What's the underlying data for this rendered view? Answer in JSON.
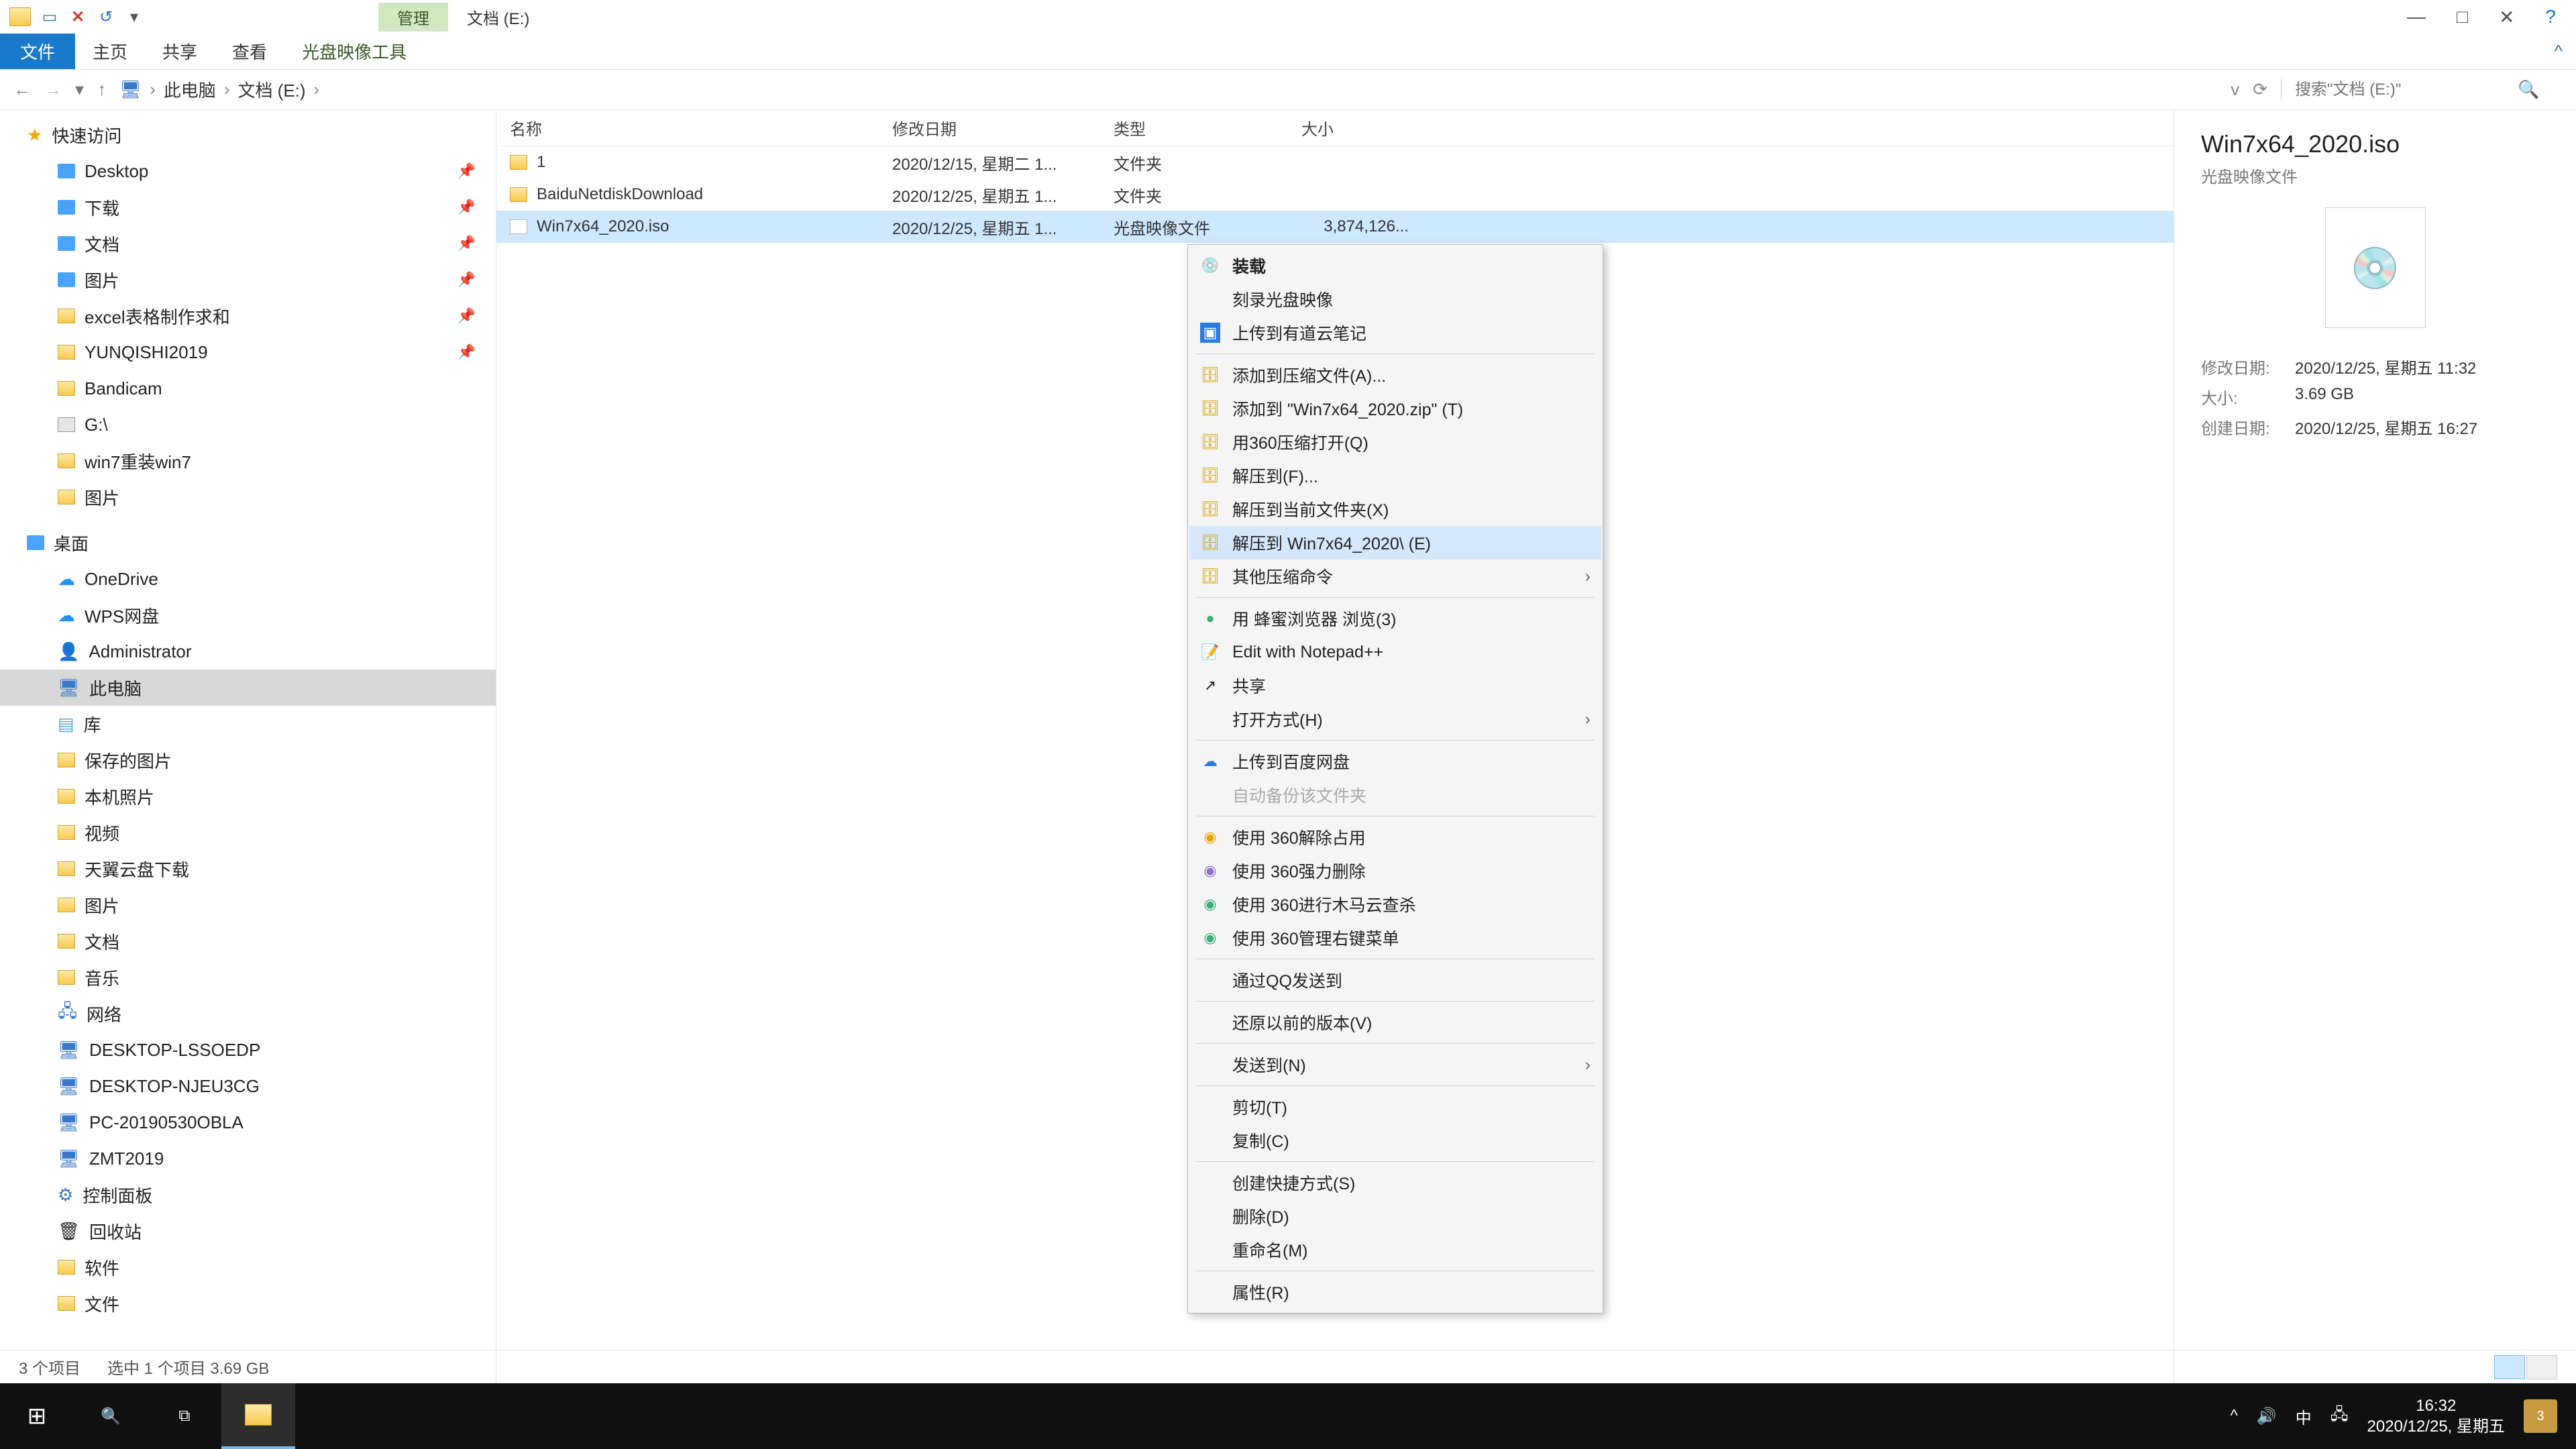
{
  "title_context_tab": "管理",
  "title_location": "文档 (E:)",
  "ribbon": {
    "file": "文件",
    "home": "主页",
    "share": "共享",
    "view": "查看",
    "disc_tools": "光盘映像工具"
  },
  "breadcrumb": {
    "pc": "此电脑",
    "drive": "文档 (E:)"
  },
  "search_placeholder": "搜索\"文档 (E:)\"",
  "columns": {
    "name": "名称",
    "date": "修改日期",
    "type": "类型",
    "size": "大小"
  },
  "sidebar": {
    "quick": "快速访问",
    "desktop": "Desktop",
    "downloads": "下载",
    "documents": "文档",
    "pictures": "图片",
    "excel": "excel表格制作求和",
    "yunqishi": "YUNQISHI2019",
    "bandicam": "Bandicam",
    "g_drive": "G:\\",
    "win7reinstall": "win7重装win7",
    "pictures2": "图片",
    "desktop_cn": "桌面",
    "onedrive": "OneDrive",
    "wps": "WPS网盘",
    "admin": "Administrator",
    "this_pc": "此电脑",
    "library": "库",
    "saved_pics": "保存的图片",
    "camera_roll": "本机照片",
    "videos": "视频",
    "tianyi": "天翼云盘下载",
    "pics3": "图片",
    "docs3": "文档",
    "music": "音乐",
    "network": "网络",
    "pc1": "DESKTOP-LSSOEDP",
    "pc2": "DESKTOP-NJEU3CG",
    "pc3": "PC-20190530OBLA",
    "pc4": "ZMT2019",
    "control_panel": "控制面板",
    "recycle": "回收站",
    "software": "软件",
    "files": "文件"
  },
  "files": [
    {
      "name": "1",
      "date": "2020/12/15, 星期二 1...",
      "type": "文件夹",
      "size": ""
    },
    {
      "name": "BaiduNetdiskDownload",
      "date": "2020/12/25, 星期五 1...",
      "type": "文件夹",
      "size": ""
    },
    {
      "name": "Win7x64_2020.iso",
      "date": "2020/12/25, 星期五 1...",
      "type": "光盘映像文件",
      "size": "3,874,126..."
    }
  ],
  "context_menu": {
    "mount": "装载",
    "burn": "刻录光盘映像",
    "youdao": "上传到有道云笔记",
    "add_archive": "添加到压缩文件(A)...",
    "add_zip": "添加到 \"Win7x64_2020.zip\" (T)",
    "open_360": "用360压缩打开(Q)",
    "extract_to": "解压到(F)...",
    "extract_here": "解压到当前文件夹(X)",
    "extract_named": "解压到 Win7x64_2020\\ (E)",
    "other_compress": "其他压缩命令",
    "fengmi": "用 蜂蜜浏览器 浏览(3)",
    "notepad": "Edit with Notepad++",
    "share": "共享",
    "open_with": "打开方式(H)",
    "baidu_upload": "上传到百度网盘",
    "auto_backup": "自动备份该文件夹",
    "unlock_360": "使用 360解除占用",
    "force_del_360": "使用 360强力删除",
    "trojan_360": "使用 360进行木马云查杀",
    "manage_360": "使用 360管理右键菜单",
    "qq_send": "通过QQ发送到",
    "restore": "还原以前的版本(V)",
    "send_to": "发送到(N)",
    "cut": "剪切(T)",
    "copy": "复制(C)",
    "shortcut": "创建快捷方式(S)",
    "delete": "删除(D)",
    "rename": "重命名(M)",
    "properties": "属性(R)"
  },
  "details": {
    "title": "Win7x64_2020.iso",
    "subtitle": "光盘映像文件",
    "mod_label": "修改日期:",
    "mod_val": "2020/12/25, 星期五 11:32",
    "size_label": "大小:",
    "size_val": "3.69 GB",
    "create_label": "创建日期:",
    "create_val": "2020/12/25, 星期五 16:27"
  },
  "status": {
    "count": "3 个项目",
    "selected": "选中 1 个项目  3.69 GB"
  },
  "taskbar": {
    "ime": "中",
    "time": "16:32",
    "date": "2020/12/25, 星期五",
    "notif_badge": "3"
  }
}
